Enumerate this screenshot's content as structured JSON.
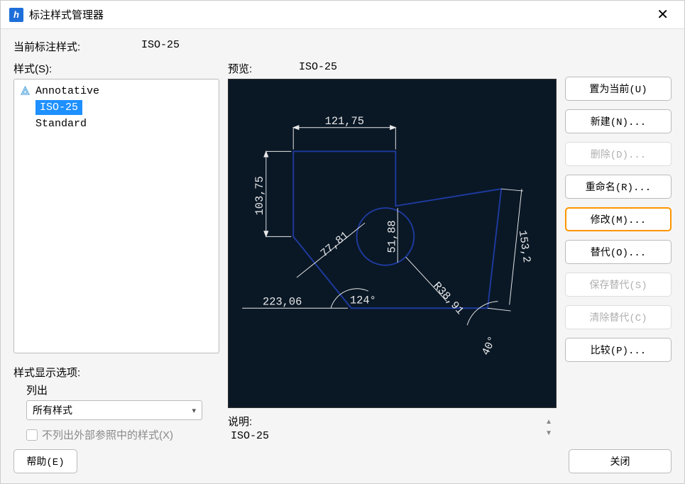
{
  "window": {
    "title": "标注样式管理器"
  },
  "current": {
    "label": "当前标注样式:",
    "value": "ISO-25"
  },
  "stylesSection": {
    "label": "样式(S):"
  },
  "styles": {
    "items": [
      {
        "name": "Annotative",
        "annotative": true
      },
      {
        "name": "ISO-25",
        "selected": true
      },
      {
        "name": "Standard"
      }
    ]
  },
  "displayOptions": {
    "title": "样式显示选项:",
    "listLabel": "列出",
    "selected": "所有样式",
    "checkboxLabel": "不列出外部参照中的样式(X)"
  },
  "preview": {
    "label": "预览:",
    "styleName": "ISO-25",
    "dims": {
      "top": "121,75",
      "left": "103,75",
      "diag": "77,81",
      "inner": "51,88",
      "right": "153,2",
      "radius": "R38,91",
      "angle1": "124°",
      "angle2": "40°",
      "bottom": "223,06"
    }
  },
  "description": {
    "label": "说明:",
    "value": "ISO-25"
  },
  "buttons": {
    "setCurrent": "置为当前(U)",
    "new": "新建(N)...",
    "delete": "删除(D)...",
    "rename": "重命名(R)...",
    "modify": "修改(M)...",
    "override": "替代(O)...",
    "saveOverride": "保存替代(S)",
    "clearOverride": "清除替代(C)",
    "compare": "比较(P)...",
    "help": "帮助(E)",
    "close": "关闭"
  }
}
